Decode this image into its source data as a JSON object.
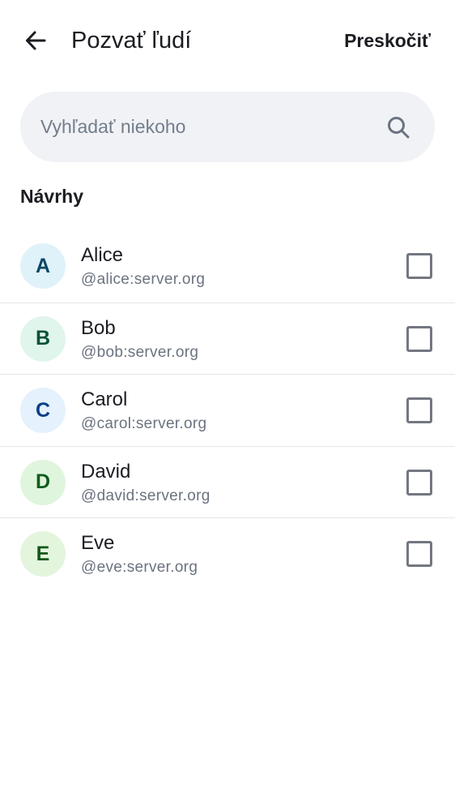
{
  "header": {
    "title": "Pozvať ľudí",
    "skip_label": "Preskočiť"
  },
  "search": {
    "placeholder": "Vyhľadať niekoho",
    "value": ""
  },
  "suggestions": {
    "title": "Návrhy",
    "items": [
      {
        "initial": "A",
        "name": "Alice",
        "handle": "@alice:server.org",
        "avatar_bg": "#e0f2f9",
        "avatar_fg": "#0b4766",
        "checked": false
      },
      {
        "initial": "B",
        "name": "Bob",
        "handle": "@bob:server.org",
        "avatar_bg": "#e0f5ec",
        "avatar_fg": "#0a5236",
        "checked": false
      },
      {
        "initial": "C",
        "name": "Carol",
        "handle": "@carol:server.org",
        "avatar_bg": "#e5f1fc",
        "avatar_fg": "#0b3f86",
        "checked": false
      },
      {
        "initial": "D",
        "name": "David",
        "handle": "@david:server.org",
        "avatar_bg": "#e0f5dd",
        "avatar_fg": "#0f5c1e",
        "checked": false
      },
      {
        "initial": "E",
        "name": "Eve",
        "handle": "@eve:server.org",
        "avatar_bg": "#e3f5dd",
        "avatar_fg": "#13571a",
        "checked": false
      }
    ]
  },
  "icons": {
    "back": "arrow-left-icon",
    "search": "search-icon",
    "checkbox": "checkbox-unchecked"
  }
}
